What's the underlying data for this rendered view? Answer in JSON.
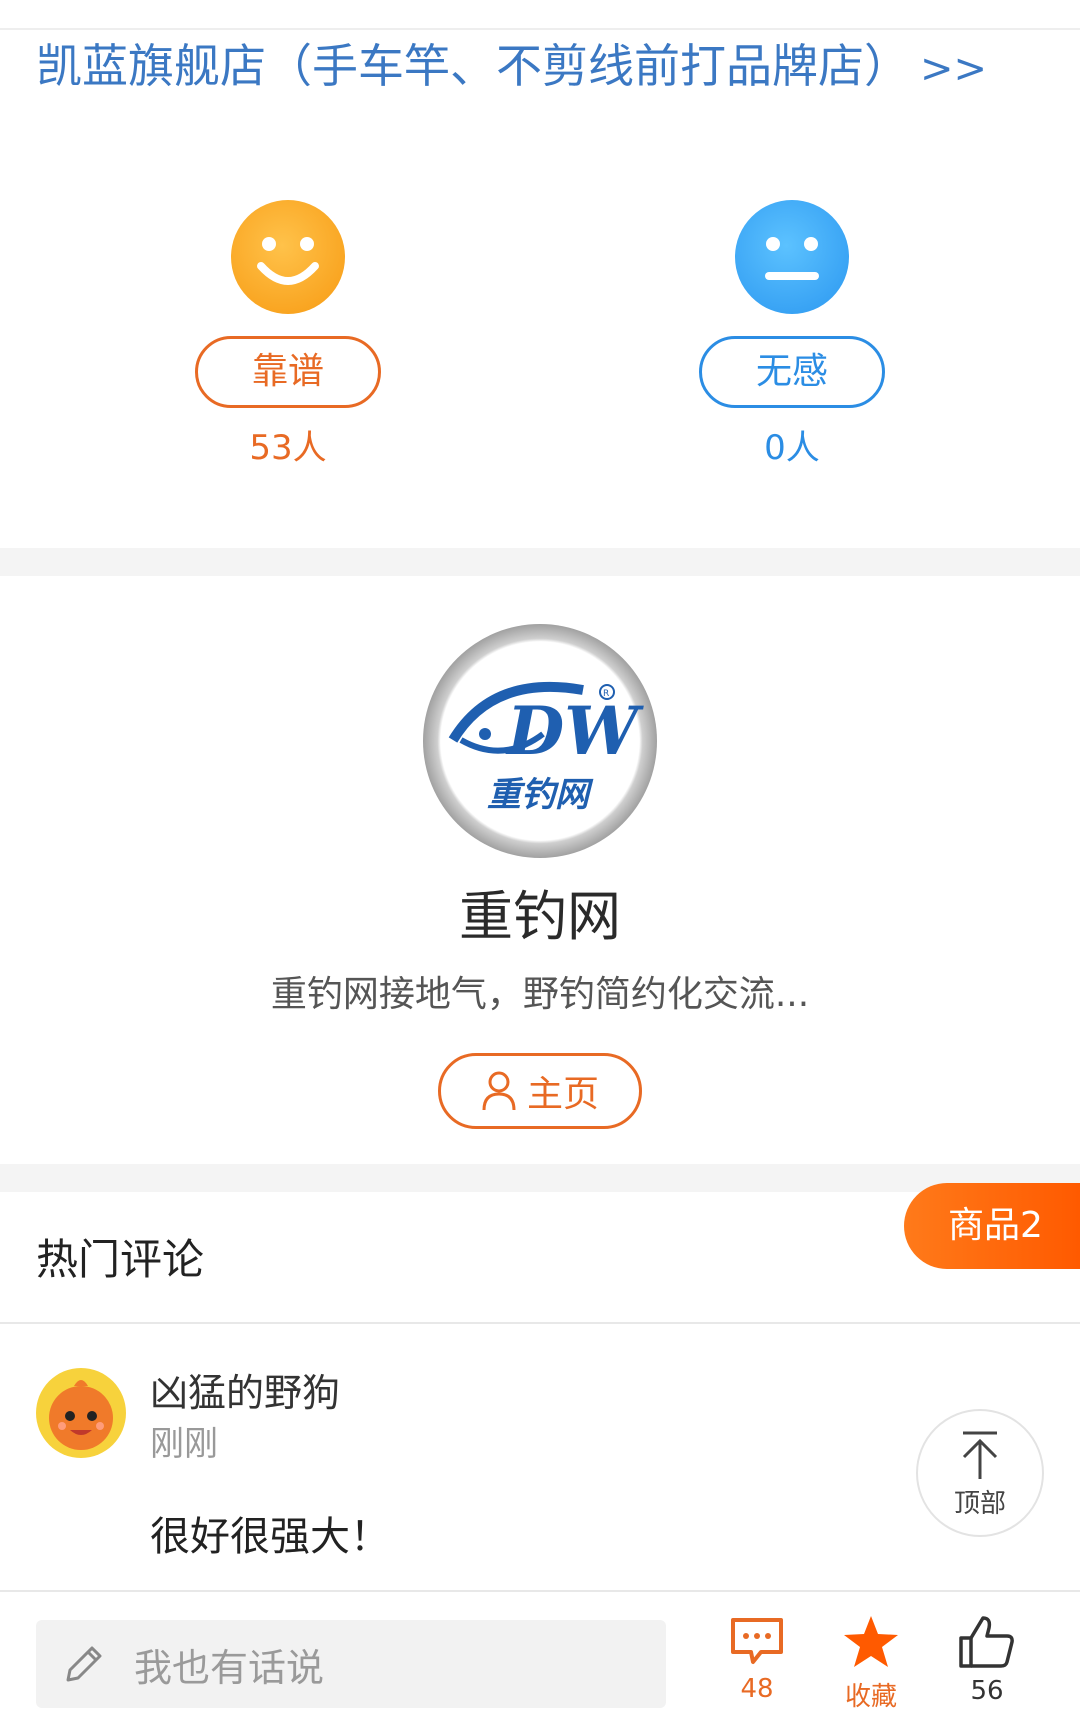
{
  "store": {
    "link_text": "凯蓝旗舰店（手车竿、不剪线前打品牌店）",
    "arrows": ">>"
  },
  "ratings": [
    {
      "label": "靠谱",
      "count": "53人",
      "face": "smile-icon",
      "color": "#e86a24"
    },
    {
      "label": "无感",
      "count": "0人",
      "face": "neutral-face-icon",
      "color": "#2b8de4"
    }
  ],
  "author": {
    "logo_text": "DW",
    "logo_sub": "重钓网",
    "name": "重钓网",
    "desc": "重钓网接地气，野钓简约化交流...",
    "home_label": "主页"
  },
  "comments_section": {
    "title": "热门评论",
    "goods_tab": "商品2"
  },
  "comments": [
    {
      "user": "凶猛的野狗",
      "time": "刚刚",
      "text": "很好很强大！"
    }
  ],
  "to_top": {
    "label": "顶部"
  },
  "bottom_bar": {
    "placeholder": "我也有话说",
    "comment_count": "48",
    "favorite_label": "收藏",
    "like_count": "56"
  },
  "colors": {
    "accent": "#e86a24",
    "blue": "#2b8de4",
    "link": "#3b78c3"
  }
}
